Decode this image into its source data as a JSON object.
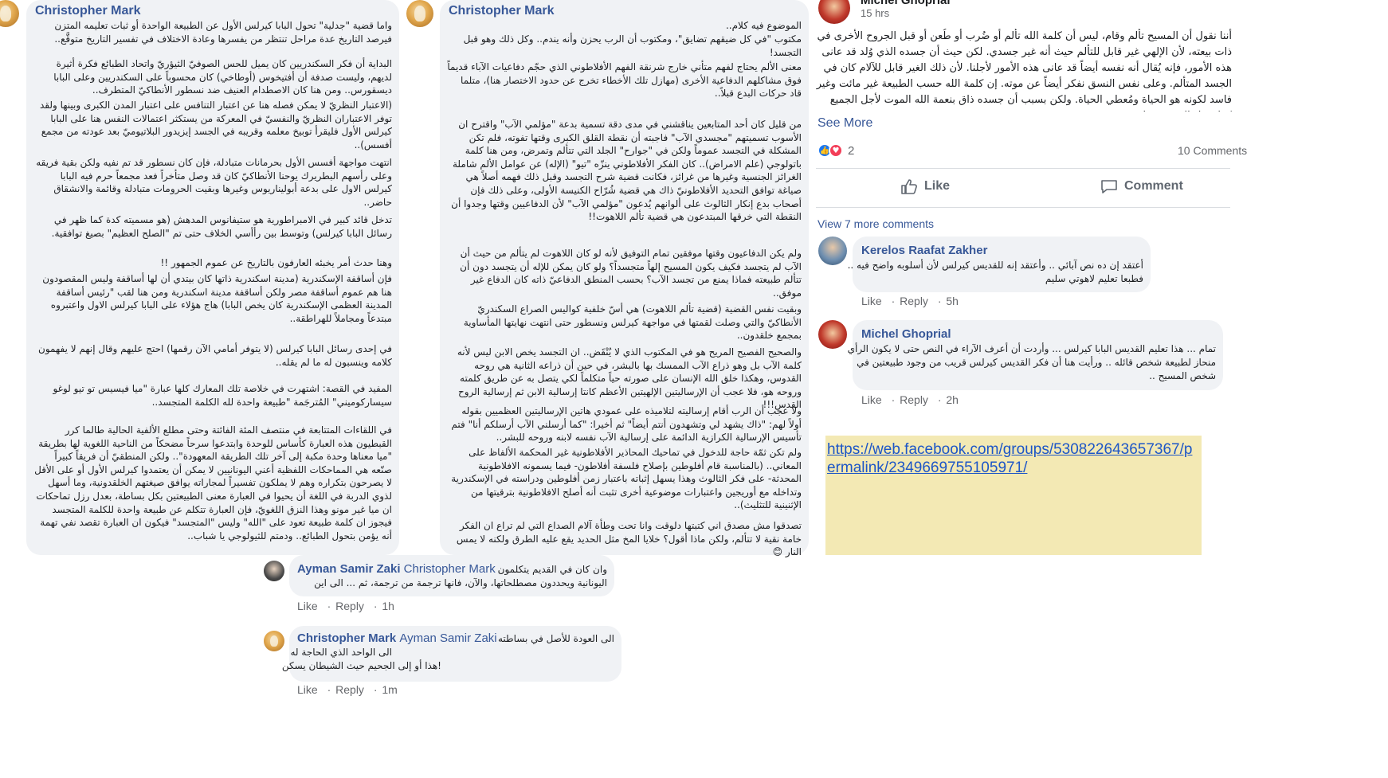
{
  "left_post": {
    "author": "Christopher Mark",
    "paragraphs": [
      "واما قضية \"جدلية\" تحول البابا كيرلس الأول عن الطبيعة الواحدة أو ثبات تعليمه المتزن فيرصد التاريخ عدة مراحل تنتظر من يفسرها وعادة الاختلاف في تفسير التاريخ متوقَّع..",
      "البداية أن فكر السكندريين كان يميل للحس الصوفيّ الثيؤريّ واتحاد الطبائع فكرة أثيرة لديهم، وليست صدفة أن أفتيخوس (أوطاخي) كان محسوباً على السكندريين وعلى البابا ديسقورس.. ومن هنا كان الاصطدام العنيف ضد نسطور الأنطاكيّ المتطرف..",
      "(الاعتبار النظريّ لا يمكن فصله هنا عن اعتبار التنافس على اعتبار المدن الكبرى وبينها ولقد توفر الاعتباران النظريّ والنفسيّ في المعركة من يستكثر اعتمالات النفس هنا على البابا كيرلس الأول فليقرأ توبيخ معلمه وقريبه في الجسد إيزيدور البلاتيوميّ بعد عودته من مجمع أفسس)..",
      "انتهت مواجهة أفسس الأول بحرمانات متبادلة، فإن كان نسطور قد تم نفيه ولكن بقية فريقه وعلى رأسهم البطريرك يوحنا الأنطاكيّ كان قد وصل متأخراً فعد مجمعاً حرم فيه البابا كيرلس الاول على بدعة أبوليناريوس وغيرها وبقيت الحرومات متبادلة وقائمة والانشقاق حاضر..",
      "تدخل قائد كبير في الامبراطورية هو ستيفانوس المدهش (هو مسميته كدة كما ظهر في رسائل البابا كيرلس) وتوسط بين رأأسي الخلاف حتى تم \"الصلح العظيم\" بصيغ توافقية.",
      "وهنا حدث أمر يخبئه العارفون بالتاريخ عن عموم الجمهور !!",
      "فإن أساقفة الإسكندرية (مدينة اسكندرية ذاتها كان بيتدي أن لها أساقفة وليس المقصودون هنا هم عموم أساقفة مصر ولكن أساقفة مدينة اسكندرية ومن هنا لقب \"رئيس أساقفة المدينة العظمى الإسكندرية كان يخص البابا) هاج هؤلاء على البابا كيرلس الاول واعتبروه مبتدعاً ومجاملاً للهراطقة..",
      "في إحدى رسائل البابا كيرلس (لا يتوفر أمامي الآن رقمها) احتج عليهم وقال إنهم لا يفهمون كلامه وينسبون له ما لم يقله..",
      "المفيد في القصة: اشتهرت في خلاصة تلك المعارك كلها عبارة \"ميا فيسيس تو تيو لوغو سيساركوميني\" المُترجَمة \"طبيعة واحدة لله الكلمة المتجسد..",
      "في اللقاءات المتتابعة في منتصف المئة الفائتة وحتى مطلع الألفية الحالية طالما كرر القبطيون هذه العبارة كأساس للوحدة وابتدعوا سرحاً مضحكاً من الناحية اللغوية لها بطريقة \"ميا معناها وحدة مكبة إلى آخر تلك الطريقة المعهودة\".. ولكن المنطقيّ أن فريقاً كبيراً صنّعه هي المماحكات اللفظية أعني اليونانيين لا يمكن أن يعتمدوا كيرلس الأول أو على الأقل لا يصرحون بتكراره وهم لا يملكون تفسيراً لمجاراته يوافق صيغتهم الخلقدونية، وما أسهل لذوي الدربة في اللغة أن يحيوا في العبارة معنى الطبيعتين بكل بساطة، بعدل رزل تماحكات ان ميا غير مونو وهذا النزق اللغويّ، فإن العبارة تتكلم عن طبيعة واحدة للكلمة المتجسد فيجوز ان كلمة طبيعة تعود على \"الله\" وليس \"المتجسد\" فيكون ان العبارة تقصد نفي تهمة أنه يؤمن بتحول الطبائع.. ودمتم للثيولوجي يا شباب.."
    ]
  },
  "middle_post": {
    "author": "Christopher Mark",
    "paragraphs": [
      "الموضوع فيه كلام..",
      "مكتوب \"في كل ضيقهم تضايق\"، ومكتوب أن الرب يحزن وأنه يندم.. وكل ذلك وهو قبل التجسد!",
      "معنى الألم يحتاج لفهم متأني خارج شرنقة الفهم الأفلاطوني الذي حجّم دفاعيات الآباء قديماً فوق مشاكلهم الدفاعية الأخرى (مهازل تلك الأخطاء تخرج عن حدود الاختصار هنا)، متلما قاد حركات البدع قبلاً..",
      "من قليل كان أحد المتابعين يناقشني في مدى دقة تسمية بدعة \"مؤلمي الآب\" واقترح ان الأسوب تسميتهم \"مجسدي الآب\" فاجبته أن نقطة القلق الكبرى وقتها تفوته، فلم تكن المشكلة في التجسد عموماً ولكن في \"جوارح\" الجلد التي تتألم وتمرض، ومن هنا كلمة باتولوجي (علم الامراض).. كان الفكر الأفلاطوني ينزّه \"تيو\" (الإله) عن عوامل الألم شاملة الغرائز الجنسية وغيرها من غرائز، فكانت قضية شرح التجسد وقبل ذلك فهمه أصلاً هي صياغة توافق التحديد الأفلاطونيّ ذاك هي قضية شُرّاح الكنيسة الأولى، وعلى ذلك فإن أصحاب بدع إنكار الثالوث على ألوانهم يُدعون \"مؤلمي الآب\" لأن الدفاعيين وقتها وجدوا أن النقطة التي خرقها المبتدعون هي قضية تألم اللاهوت!!",
      "ولم يكن الدفاعيون وقتها موفقين تمام التوفيق لأنه لو كان اللاهوت لم يتألم من حيث أن الآب لم يتجسد فكيف يكون المسيح إلهاً متجسداً؟ ولو كان يمكن للإله أن يتجسد دون أن تتألم طبيعته فماذا يمنع من تجسد الآب؟ بحسب المنطق الدفاعيّ ذاته كان الدفاع غير موفق..",
      "وبقيت نفس القضية (قضية تألم اللاهوت) هي أسّ خلفية كواليس الصراع السكندريّ الأنطاكيّ والتي وصلت لقمتها في مواجهة كيرلس ونسطور حتى انتهت نهايتها المأساوية بمجمع خلقدون..",
      "والصحيح الفصيح المريح هو في المكتوب الذي لا يُنْقَض.. ان التجسد يخص الابن ليس لأنه كلمة الآب بل وهو ذراع الآب الممسك بها بالبشر، في حين أن ذراعه الثانية هي روحه القدوس، وهكذا خلق الله الإنسان على صورته حياً متكلماً لكي يتصل به عن طريق كلمته وروحه هو، فلا عجب أن الإرساليتين الإلهيتين الأعظم كانتا إرسالية الابن ثم إرسالية الروح القدس!!!",
      "ولا عجب أن الرب أقام إرساليته لتلاميذه على عمودي هاتين الإرساليتين العظميين بقوله أولاً لهم: \"ذاك يشهد لي وتشهدون أنتم أيضاً\" ثم أخيرا: \"كما أرسلني الآب أرسلكم أنا\" فتم تأسيس الإرسالية الكرازية الدائمة على إرسالية الآب نفسه لابنه وروحه للبشر..",
      "ولم تكن ثمّة حاجة للدخول في تماحيك المحاذير الأفلاطونية غير المحكمة الألفاظ على المعاني.. (بالمناسبة قام أفلوطين بإصلاح فلسفة أفلاطون- فيما يسمونه الافلاطونية المحدثة- على فكر الثالوث وهذا يسهل إثباته باعتبار زمن أفلوطين ودراسته في الإسكندرية وتداخله مع أوريجين واعتبارات موضوعية أخرى تثبت أنه أصلح الافلاطونية بترقيتها من الإثنينية للتثليث)..",
      "تصدقوا مش مصدق اني كتبتها دلوقت وانا تحت وطأة آلام الصداع التي لم تراع ان الفكر خامة نقية لا تتألم، ولكن ماذا أقول؟ خلايا المخ مثل الحديد يقع عليه الطرق ولكنه لا يمس النار 😊"
    ]
  },
  "right_post": {
    "author": "Michel Ghoprial",
    "time": "15 hrs",
    "body": "أننا نقول أن المسيح تألم وقام، ليس أن كلمة الله تألم أو ضُرب أو طُعن أو قبل الجروح الأخرى في ذات بيعته، لأن الإلهي غير قابل للتألم حيث أنه غير جسدي. لكن حيث أن جسده الذي وُلد قد عانى هذه الأمور، فإنه يُقال أنه نفسه أيضاً قد عانى هذه الأمور لأجلنا. لأن ذلك الغير قابل للآلام كان في الجسد المتألم. وعلى نفس النسق نفكر أيضاً عن موته. إن كلمة الله حسب الطبيعة غير مائت وغير فاسد لكونه هو الحياة ومُعطي الحياة. ولكن بسبب أن جسده ذاق بنعمة الله الموت لأجل الجميع كما يقول القديس بولس ...",
    "see_more": "See More",
    "reactions_count": "2",
    "comments_count": "10 Comments",
    "like_label": "Like",
    "comment_label": "Comment",
    "view_more": "View 7 more comments",
    "comments": [
      {
        "author": "Kerelos Raafat Zakher",
        "text_line1": "أعتقد إن ده نص آبائي .. وأعتقد إنه للقديس كيرلس لأن أسلوبه واضح فيه ..",
        "text_line2": "فطبعا تعليم لاهوتي سليم",
        "like": "Like",
        "reply": "Reply",
        "time": "5h"
      },
      {
        "author": "Michel Ghoprial",
        "text_line1": "تمام ... هذا تعليم القديس البابا كيرلس ... وأردت أن أعرف الآراء في النص حتى لا يكون الرأي",
        "text_line2": "منحاز لطبيعة شخص قائله .. ورأيت هنا أن فكر القديس كيرلس قريب من وجود طبيعتين في",
        "text_line3": "شخص المسيح ..",
        "like": "Like",
        "reply": "Reply",
        "time": "2h"
      }
    ],
    "link_url": "https://web.facebook.com/groups/530822643657367/permalink/2349669755105971/"
  },
  "bottom_thread": [
    {
      "author": "Ayman Samir Zaki",
      "mention": "Christopher Mark",
      "text_line1": "وان كان في القديم يتكلمون",
      "text_line2": "اليونانية ويحددون مصطلحاتها، والآن، فانها ترجمة من ترجمة، ثم ... الى اين",
      "like": "Like",
      "reply": "Reply",
      "time": "1h"
    },
    {
      "author": "Christopher Mark",
      "mention": "Ayman Samir Zaki",
      "text_line1": "الى العودة للأصل في بساطته",
      "text_line2": "الى الواحد الذي الحاجة له",
      "text_line3": "!هذا أو إلى الجحيم حيث الشيطان يسكن",
      "like": "Like",
      "reply": "Reply",
      "time": "1m"
    }
  ]
}
